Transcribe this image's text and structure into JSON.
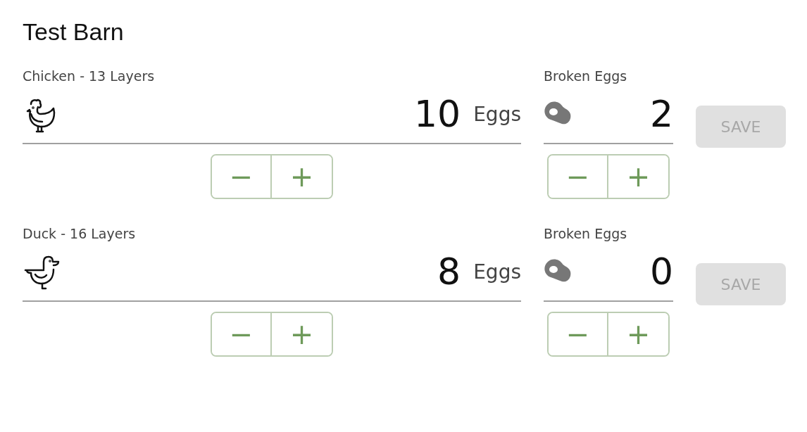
{
  "title": "Test Barn",
  "rows": [
    {
      "label": "Chicken - 13 Layers",
      "kind": "chicken",
      "count": "10",
      "unit": "Eggs",
      "broken_label": "Broken Eggs",
      "broken": "2",
      "minus": "−",
      "plus": "+",
      "broken_minus": "−",
      "broken_plus": "+",
      "save": {
        "label": "SAVE",
        "disabled": true
      }
    },
    {
      "label": "Duck - 16 Layers",
      "kind": "duck",
      "count": "8",
      "unit": "Eggs",
      "broken_label": "Broken Eggs",
      "broken": "0",
      "minus": "−",
      "plus": "+",
      "broken_minus": "−",
      "broken_plus": "+",
      "save": {
        "label": "SAVE",
        "disabled": true
      }
    }
  ]
}
